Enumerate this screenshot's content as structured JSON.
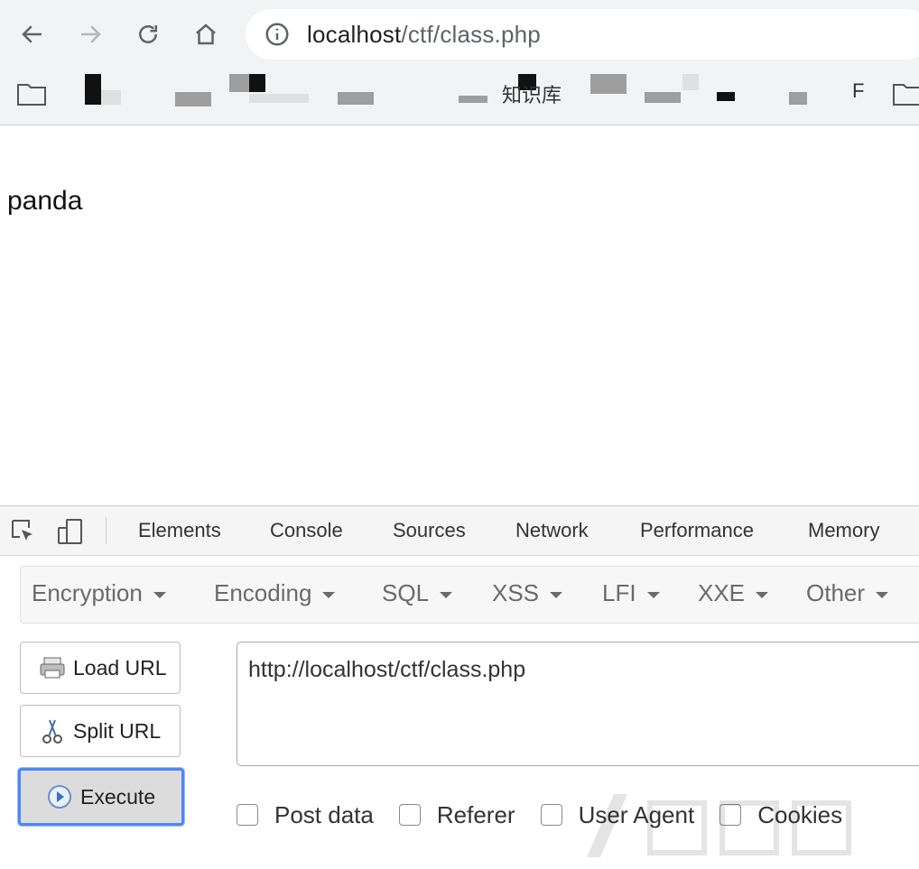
{
  "browser": {
    "nav": {
      "back_icon": "arrow-left-icon",
      "forward_icon": "arrow-right-icon",
      "reload_icon": "reload-icon",
      "home_icon": "home-icon"
    },
    "address": {
      "host": "localhost",
      "path": "/ctf/class.php"
    },
    "bookmarks": {
      "visible_text_1": "知识库",
      "visible_text_2": "F"
    }
  },
  "page": {
    "body_text": "panda"
  },
  "devtools": {
    "tabs": [
      "Elements",
      "Console",
      "Sources",
      "Network",
      "Performance",
      "Memory"
    ],
    "hackbar": {
      "menu": [
        "Encryption",
        "Encoding",
        "SQL",
        "XSS",
        "LFI",
        "XXE",
        "Other"
      ],
      "buttons": {
        "load": "Load URL",
        "split": "Split URL",
        "execute": "Execute"
      },
      "url_value": "http://localhost/ctf/class.php",
      "options": [
        "Post data",
        "Referer",
        "User Agent",
        "Cookies"
      ]
    }
  },
  "colors": {
    "chrome_bg": "#f1f3f4",
    "focus_blue": "#4f86f7"
  }
}
